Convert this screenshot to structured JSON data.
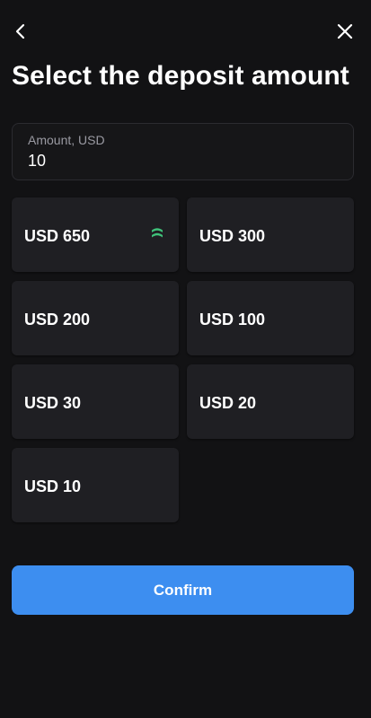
{
  "header": {
    "back_icon": "chevron-left-icon",
    "close_icon": "close-icon",
    "title": "Select the deposit amount"
  },
  "amount": {
    "label": "Amount, USD",
    "value": "10"
  },
  "options": [
    {
      "label": "USD 650",
      "bonus": true
    },
    {
      "label": "USD 300",
      "bonus": false
    },
    {
      "label": "USD 200",
      "bonus": false
    },
    {
      "label": "USD 100",
      "bonus": false
    },
    {
      "label": "USD 30",
      "bonus": false
    },
    {
      "label": "USD 20",
      "bonus": false
    },
    {
      "label": "USD 10",
      "bonus": false
    }
  ],
  "bonus_icon": "bonus-badge-icon",
  "confirm": {
    "label": "Confirm"
  },
  "colors": {
    "background": "#121214",
    "tile": "#1f1f23",
    "accent": "#3d8ef0",
    "bonus": "#3fc27a"
  }
}
